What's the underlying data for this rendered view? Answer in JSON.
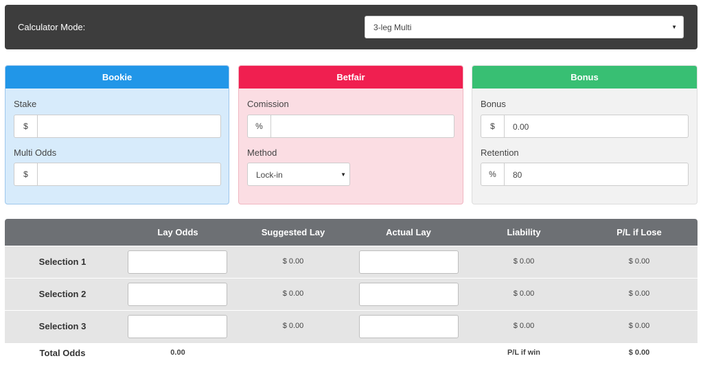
{
  "calculator": {
    "mode_label": "Calculator Mode:",
    "mode_value": "3-leg Multi"
  },
  "bookie": {
    "title": "Bookie",
    "stake_label": "Stake",
    "stake_addon": "$",
    "stake_value": "",
    "odds_label": "Multi Odds",
    "odds_addon": "$",
    "odds_value": ""
  },
  "betfair": {
    "title": "Betfair",
    "commission_label": "Comission",
    "commission_addon": "%",
    "commission_value": "",
    "method_label": "Method",
    "method_value": "Lock-in"
  },
  "bonus": {
    "title": "Bonus",
    "bonus_label": "Bonus",
    "bonus_addon": "$",
    "bonus_value": "0.00",
    "retention_label": "Retention",
    "retention_addon": "%",
    "retention_value": "80"
  },
  "table": {
    "headers": [
      "Lay Odds",
      "Suggested Lay",
      "Actual Lay",
      "Liability",
      "P/L if Lose"
    ],
    "rows": [
      {
        "label": "Selection 1",
        "suggested_lay": "$ 0.00",
        "liability": "$ 0.00",
        "pl_lose": "$ 0.00"
      },
      {
        "label": "Selection 2",
        "suggested_lay": "$ 0.00",
        "liability": "$ 0.00",
        "pl_lose": "$ 0.00"
      },
      {
        "label": "Selection 3",
        "suggested_lay": "$ 0.00",
        "liability": "$ 0.00",
        "pl_lose": "$ 0.00"
      }
    ],
    "total": {
      "label": "Total Odds",
      "odds_value": "0.00",
      "pl_win_label": "P/L if win",
      "pl_win_value": "$ 0.00"
    }
  },
  "icons": {
    "select_caret": "▼"
  }
}
